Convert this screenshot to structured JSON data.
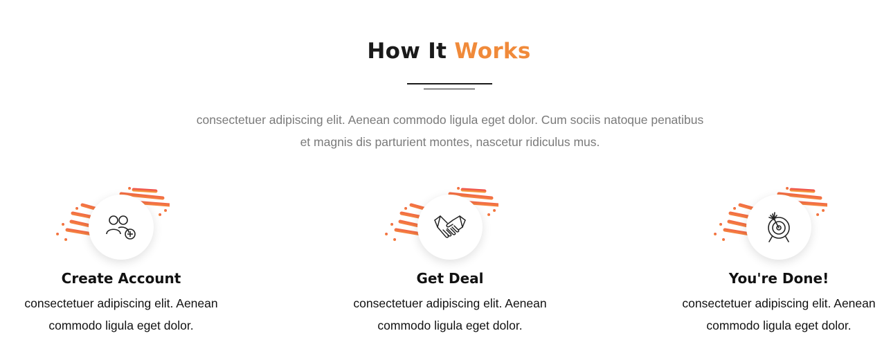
{
  "section": {
    "heading_main": "How It",
    "heading_accent": "Works",
    "intro": "consectetuer adipiscing elit. Aenean commodo ligula eget dolor. Cum sociis natoque penatibus et magnis dis parturient montes, nascetur ridiculus mus."
  },
  "steps": [
    {
      "icon": "users-add-icon",
      "title": "Create Account",
      "description": "consectetuer adipiscing elit. Aenean commodo ligula eget dolor."
    },
    {
      "icon": "handshake-icon",
      "title": "Get Deal",
      "description": "consectetuer adipiscing elit. Aenean commodo ligula eget dolor."
    },
    {
      "icon": "target-icon",
      "title": "You're Done!",
      "description": "consectetuer adipiscing elit. Aenean commodo ligula eget dolor."
    }
  ],
  "colors": {
    "accent": "#f08a3a",
    "heading": "#1a1a1a",
    "intro_text": "#7a7a7a",
    "decor_red": "#ee4a4a",
    "decor_orange": "#f7a13b"
  }
}
